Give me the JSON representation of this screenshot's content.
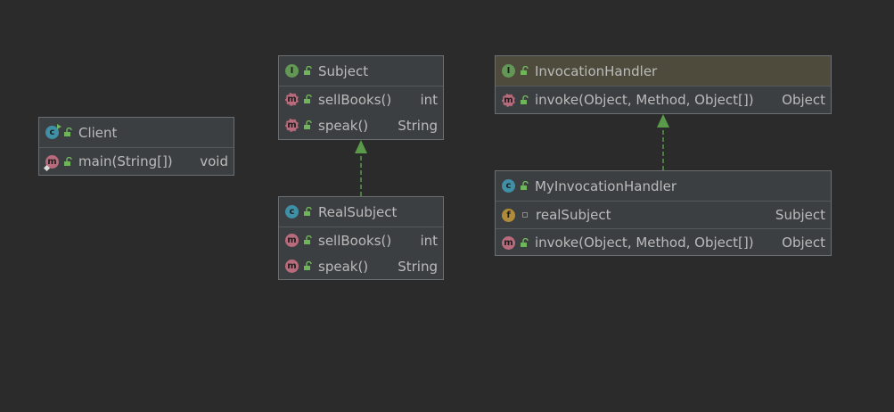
{
  "classes": {
    "client": {
      "name": "Client",
      "kind": "c",
      "methods": [
        {
          "badge": "m",
          "name": "main(String[])",
          "type": "void"
        }
      ]
    },
    "subject": {
      "name": "Subject",
      "kind": "I",
      "methods": [
        {
          "badge": "m",
          "name": "sellBooks()",
          "type": "int"
        },
        {
          "badge": "m",
          "name": "speak()",
          "type": "String"
        }
      ]
    },
    "real_subject": {
      "name": "RealSubject",
      "kind": "c",
      "methods": [
        {
          "badge": "m",
          "name": "sellBooks()",
          "type": "int"
        },
        {
          "badge": "m",
          "name": "speak()",
          "type": "String"
        }
      ]
    },
    "invocation_handler": {
      "name": "InvocationHandler",
      "kind": "I",
      "methods": [
        {
          "badge": "m",
          "name": "invoke(Object, Method, Object[])",
          "type": "Object"
        }
      ]
    },
    "my_invocation_handler": {
      "name": "MyInvocationHandler",
      "kind": "c",
      "fields": [
        {
          "badge": "f",
          "name": "realSubject",
          "type": "Subject"
        }
      ],
      "methods": [
        {
          "badge": "m",
          "name": "invoke(Object, Method, Object[])",
          "type": "Object"
        }
      ]
    }
  },
  "colors": {
    "background": "#2b2b2b",
    "box": "#3c3f41",
    "interface_header": "#4e4b3c",
    "arrow": "#5a9a4a",
    "text": "#bbbbbb"
  }
}
